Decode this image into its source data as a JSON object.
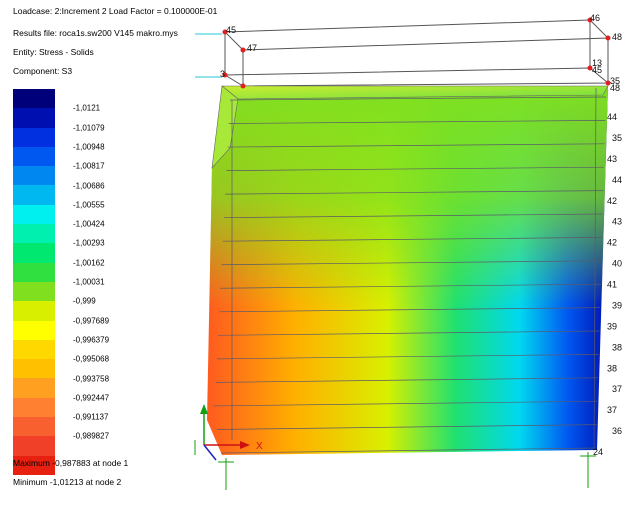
{
  "header": {
    "loadcase": "Loadcase: 2:Increment 2 Load Factor = 0.100000E-01",
    "results_file": "Results file: roca1s.sw200  V145 makro.mys",
    "entity": "Entity: Stress - Solids",
    "component": "Component: S3"
  },
  "legend": {
    "colors": [
      "#00007a",
      "#0010b0",
      "#0030e0",
      "#0058f0",
      "#0088f0",
      "#00b8f0",
      "#00f0f0",
      "#00f0b0",
      "#00e870",
      "#30e040",
      "#80e020",
      "#d8f000",
      "#ffff00",
      "#ffd800",
      "#ffc000",
      "#ffa020",
      "#ff8030",
      "#f86030",
      "#f04028",
      "#e82010"
    ],
    "labels": [
      "-1,0121",
      "-1,01079",
      "-1,00948",
      "-1,00817",
      "-1,00686",
      "-1,00555",
      "-1,00424",
      "-1,00293",
      "-1,00162",
      "-1,00031",
      "-0,999",
      "-0,997689",
      "-0,996379",
      "-0,995068",
      "-0,993758",
      "-0,992447",
      "-0,991137",
      "-0,989827"
    ]
  },
  "stats": {
    "maximum": "Maximum -0,987883 at node 1",
    "minimum": "Minimum -1,01213 at node 2"
  },
  "viewport": {
    "top_nodes": [
      "46",
      "45",
      "47",
      "48",
      "3",
      "13",
      "45",
      "35",
      "48"
    ],
    "right_node_labels": [
      "44",
      "35",
      "43",
      "44",
      "42",
      "43",
      "42",
      "40",
      "41",
      "39",
      "39",
      "38",
      "38",
      "37",
      "37",
      "36",
      "24"
    ],
    "axis_x_label": "X"
  }
}
